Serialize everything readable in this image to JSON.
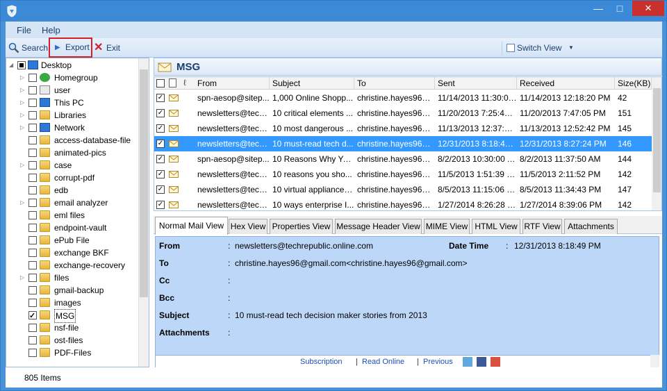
{
  "menu": {
    "file": "File",
    "help": "Help"
  },
  "toolbar": {
    "search": "Search",
    "export": "Export",
    "exit": "Exit",
    "switch_view": "Switch View"
  },
  "tree": {
    "root": "Desktop",
    "items": [
      "Homegroup",
      "user",
      "This PC",
      "Libraries",
      "Network",
      "access-database-file",
      "animated-pics",
      "case",
      "corrupt-pdf",
      "edb",
      "email analyzer",
      "eml files",
      "endpoint-vault",
      "ePub File",
      "exchange BKF",
      "exchange-recovery",
      "files",
      "gmail-backup",
      "images",
      "MSG",
      "nsf-file",
      "ost-files",
      "PDF-Files"
    ]
  },
  "folder_title": "MSG",
  "grid": {
    "headers": [
      "From",
      "Subject",
      "To",
      "Sent",
      "Received",
      "Size(KB)"
    ],
    "rows": [
      {
        "from": "spn-aesop@sitep...",
        "subject": "1,000 Online Shopp...",
        "to": "christine.hayes96@...",
        "sent": "11/14/2013 11:30:00...",
        "received": "11/14/2013 12:18:20 PM",
        "size": "42"
      },
      {
        "from": "newsletters@tech...",
        "subject": "10 critical elements ...",
        "to": "christine.hayes96@...",
        "sent": "11/20/2013 7:25:47 ...",
        "received": "11/20/2013 7:47:05 PM",
        "size": "151"
      },
      {
        "from": "newsletters@tech...",
        "subject": "10 most dangerous ...",
        "to": "christine.hayes96@...",
        "sent": "11/13/2013 12:37:20...",
        "received": "11/13/2013 12:52:42 PM",
        "size": "145"
      },
      {
        "from": "newsletters@tech...",
        "subject": "10 must-read tech d...",
        "to": "christine.hayes96@...",
        "sent": "12/31/2013 8:18:49 ...",
        "received": "12/31/2013 8:27:24 PM",
        "size": "146"
      },
      {
        "from": "spn-aesop@sitep...",
        "subject": "10 Reasons Why Yo...",
        "to": "christine.hayes96@...",
        "sent": "8/2/2013 10:30:00 AM",
        "received": "8/2/2013 11:37:50 AM",
        "size": "144"
      },
      {
        "from": "newsletters@tech...",
        "subject": "10 reasons you sho...",
        "to": "christine.hayes96@...",
        "sent": "11/5/2013 1:51:39 PM",
        "received": "11/5/2013 2:11:52 PM",
        "size": "142"
      },
      {
        "from": "newsletters@tech...",
        "subject": "10 virtual appliances...",
        "to": "christine.hayes96@...",
        "sent": "8/5/2013 11:15:06 PM",
        "received": "8/5/2013 11:34:43 PM",
        "size": "147"
      },
      {
        "from": "newsletters@tech...",
        "subject": "10 ways enterprise I...",
        "to": "christine.hayes96@...",
        "sent": "1/27/2014 8:26:28 PM",
        "received": "1/27/2014 8:39:06 PM",
        "size": "142"
      }
    ]
  },
  "tabs": [
    "Normal Mail View",
    "Hex View",
    "Properties View",
    "Message Header View",
    "MIME View",
    "HTML View",
    "RTF View",
    "Attachments"
  ],
  "detail": {
    "from_label": "From",
    "from": "newsletters@techrepublic.online.com",
    "date_label": "Date Time",
    "date": "12/31/2013 8:18:49 PM",
    "to_label": "To",
    "to": "christine.hayes96@gmail.com<christine.hayes96@gmail.com>",
    "cc_label": "Cc",
    "bcc_label": "Bcc",
    "subject_label": "Subject",
    "subject": "10 must-read tech decision maker stories from 2013",
    "attachments_label": "Attachments",
    "colon": ":",
    "links": [
      "Subscription",
      "Read Online",
      "Previous"
    ]
  },
  "status": "805 Items",
  "colors": {
    "titlebar": "#3c8ad7",
    "selection": "#3399ff",
    "detail_bg": "#bcd7f7",
    "close": "#c9302c"
  }
}
